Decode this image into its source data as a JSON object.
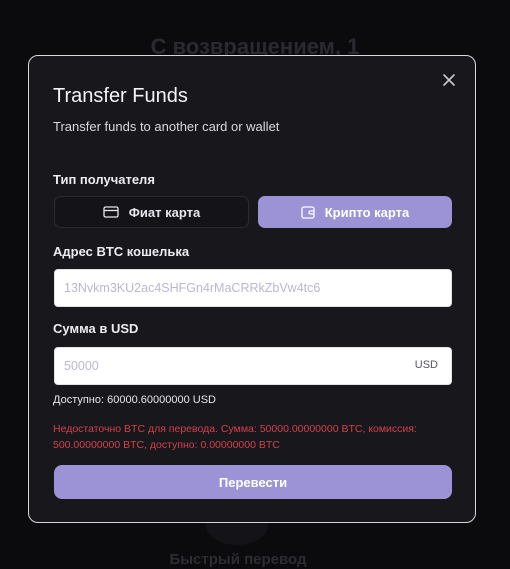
{
  "background": {
    "title": "С возвращением, 1",
    "bottom_text": "Быстрый перевод"
  },
  "modal": {
    "title": "Transfer Funds",
    "subtitle": "Transfer funds to another card or wallet",
    "close_icon": "close-icon",
    "recipient_type_label": "Тип получателя",
    "recipient_options": [
      {
        "label": "Фиат карта",
        "icon": "credit-card-icon",
        "selected": false
      },
      {
        "label": "Крипто карта",
        "icon": "wallet-icon",
        "selected": true
      }
    ],
    "wallet_label": "Адрес BTC кошелька",
    "wallet_placeholder": "13Nvkm3KU2ac4SHFGn4rMaCRRkZbVw4tc6",
    "amount_label": "Сумма в USD",
    "amount_placeholder": "50000",
    "amount_suffix": "USD",
    "available": "Доступно: 60000.60000000 USD",
    "error": "Недостаточно BTC для перевода. Сумма: 50000.00000000 BTC, комиссия: 500.00000000 BTC, доступно: 0.00000000 BTC",
    "submit_label": "Перевести"
  },
  "colors": {
    "accent": "#9b93d5",
    "error": "#d2414d",
    "modal_bg": "#18171c"
  }
}
